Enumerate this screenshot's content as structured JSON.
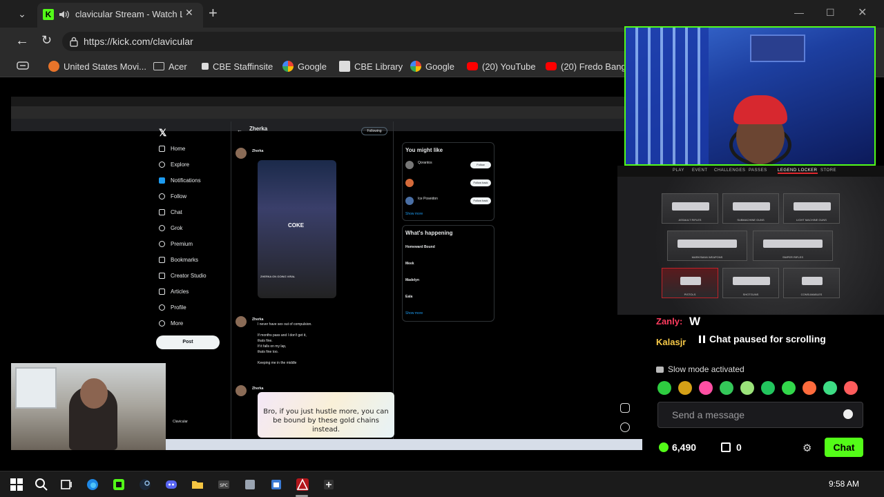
{
  "browser": {
    "tab": {
      "title": "clavicular Stream - Watch Live",
      "favicon": "K"
    },
    "url": "https://kick.com/clavicular",
    "bookmarks": [
      "United States Movi...",
      "Acer",
      "CBE Staffinsite",
      "Google",
      "CBE Library",
      "Google",
      "(20) YouTube",
      "(20) Fredo Bang -"
    ]
  },
  "stream": {
    "x": {
      "nav": [
        "Home",
        "Explore",
        "Notifications",
        "Follow",
        "Chat",
        "Grok",
        "Premium",
        "Bookmarks",
        "Creator Studio",
        "Articles",
        "Profile",
        "More"
      ],
      "post_button": "Post",
      "feed_header": "Zherka",
      "following": "Following",
      "tweet1_author": "Zherka",
      "tweet1_caption": "ZHERKA ON GOING VIRAL",
      "tweet1_overlay": "COKE",
      "tweet2_author": "Zherka",
      "tweet2_text": "I never have sex out of compulsion.\n\nIf months pass and I don't get it,\nthats fine.\nIf it falls on my lap,\nthats fine too.\n\nKeeping me in the middle",
      "tweet3_author": "Zherka",
      "tweet3_image_text": "Bro, if you just hustle more, you can be bound by these gold chains instead.",
      "you_might_like": "You might like",
      "follow_suggestions": [
        "Qorantos",
        "",
        "Ice Poseidon"
      ],
      "follow_label": "Follow",
      "follow_back_label": "Follow back",
      "show_more": "Show more",
      "whats_happening": "What's happening",
      "trends": [
        "Homeward Bound",
        "Meek",
        "Madelyn",
        "Eala"
      ],
      "account_name": "Clavicular"
    },
    "game": {
      "tabs": [
        "PLAY",
        "EVENT",
        "CHALLENGES",
        "PASSES",
        "LEGEND LOCKER",
        "STORE"
      ],
      "weapons": [
        "ASSAULT RIFLES",
        "SUBMACHINE GUNS",
        "LIGHT MACHINE GUNS",
        "MARKSMAN WEAPONS",
        "SNIPER RIFLES",
        "PISTOLS",
        "SHOTGUNS",
        "CONSUMABLES"
      ]
    }
  },
  "chat": {
    "line1_user": "Zanly:",
    "line1_msg": "W",
    "line2_user": "Kalasjr",
    "paused": "Chat paused for scrolling",
    "slow_mode": "Slow mode activated",
    "placeholder": "Send a message",
    "points": "6,490",
    "gifts": "0",
    "send_label": "Chat",
    "emote_colors": [
      "#2ecc40",
      "#d4a017",
      "#ff4fa3",
      "#34c759",
      "#9be37a",
      "#22c55e",
      "#32d74b",
      "#ff6b3d",
      "#3ddc84",
      "#ff5c5c"
    ]
  },
  "taskbar": {
    "clock": "9:58 AM"
  },
  "colors": {
    "kick_green": "#53fc18",
    "chat_button": "#53fc18"
  }
}
